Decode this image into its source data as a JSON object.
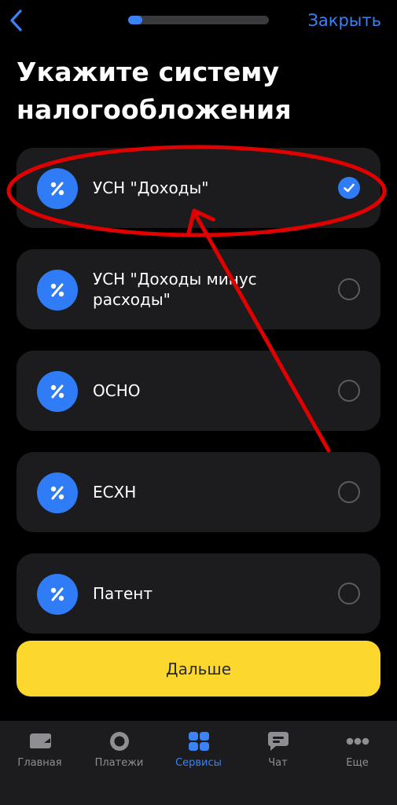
{
  "header": {
    "back_icon": "chevron-left-icon",
    "close_label": "Закрыть",
    "progress": 0.1
  },
  "page": {
    "title": "Укажите систему налогообложения"
  },
  "options": [
    {
      "label": "УСН \"Доходы\"",
      "icon": "percent-icon",
      "selected": true
    },
    {
      "label": "УСН \"Доходы минус расходы\"",
      "icon": "percent-icon",
      "selected": false
    },
    {
      "label": "ОСНО",
      "icon": "percent-icon",
      "selected": false
    },
    {
      "label": "ЕСХН",
      "icon": "percent-icon",
      "selected": false
    },
    {
      "label": "Патент",
      "icon": "percent-icon",
      "selected": false
    }
  ],
  "next_button": {
    "label": "Дальше"
  },
  "tabbar": {
    "items": [
      {
        "label": "Главная",
        "icon": "home-icon",
        "active": false
      },
      {
        "label": "Платежи",
        "icon": "payments-icon",
        "active": false
      },
      {
        "label": "Сервисы",
        "icon": "services-grid-icon",
        "active": true
      },
      {
        "label": "Чат",
        "icon": "chat-icon",
        "active": false
      },
      {
        "label": "Еще",
        "icon": "more-dots-icon",
        "active": false
      }
    ]
  },
  "colors": {
    "accent": "#3b82f6",
    "button": "#fcd82f",
    "card": "#1c1c1e",
    "annotation": "#e10000"
  }
}
